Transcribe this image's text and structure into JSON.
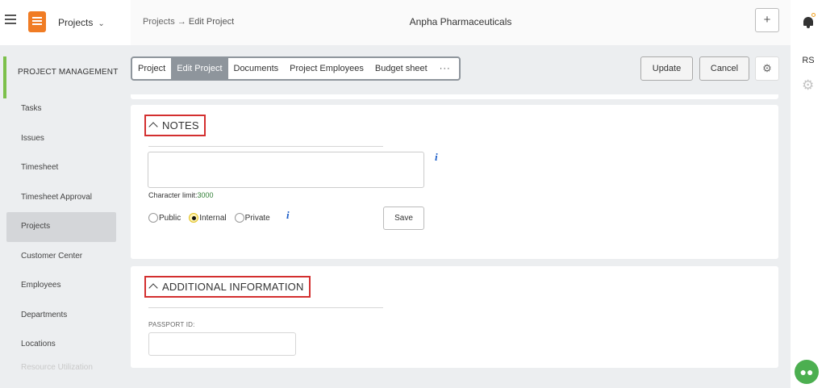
{
  "app": {
    "menu_label": "Projects",
    "company": "Anpha Pharmaceuticals"
  },
  "breadcrumb": {
    "parent": "Projects",
    "separator": "→",
    "current": "Edit Project"
  },
  "user": {
    "initials": "RS"
  },
  "sidebar": {
    "section_title": "PROJECT MANAGEMENT",
    "items": [
      {
        "label": "Tasks"
      },
      {
        "label": "Issues"
      },
      {
        "label": "Timesheet"
      },
      {
        "label": "Timesheet Approval"
      },
      {
        "label": "Projects",
        "active": true
      },
      {
        "label": "Customer Center"
      },
      {
        "label": "Employees"
      },
      {
        "label": "Departments"
      },
      {
        "label": "Locations"
      },
      {
        "label": "Resource Utilization"
      }
    ]
  },
  "tabs": [
    {
      "label": "Project"
    },
    {
      "label": "Edit Project",
      "active": true
    },
    {
      "label": "Documents"
    },
    {
      "label": "Project Employees"
    },
    {
      "label": "Budget sheet"
    },
    {
      "label": "···"
    }
  ],
  "actions": {
    "update_label": "Update",
    "cancel_label": "Cancel"
  },
  "notes": {
    "title": "NOTES",
    "textarea_value": "",
    "char_limit_label": "Character limit:",
    "char_limit_value": "3000",
    "visibility": {
      "options": [
        "Public",
        "Internal",
        "Private"
      ],
      "selected": "Internal"
    },
    "save_label": "Save"
  },
  "additional": {
    "title": "ADDITIONAL INFORMATION",
    "passport_label": "PASSPORT ID:",
    "passport_value": ""
  },
  "colors": {
    "brand": "#f07c24",
    "accent_green": "#7cc04b",
    "highlight_red": "#d32f2f",
    "info_blue": "#1a5cc8",
    "chat_green": "#4caf50"
  },
  "icons": [
    "hamburger-icon",
    "app-logo-icon",
    "chevron-down-icon",
    "plus-icon",
    "bell-icon",
    "gear-icon",
    "info-icon",
    "chat-icon",
    "caret-up-icon"
  ]
}
